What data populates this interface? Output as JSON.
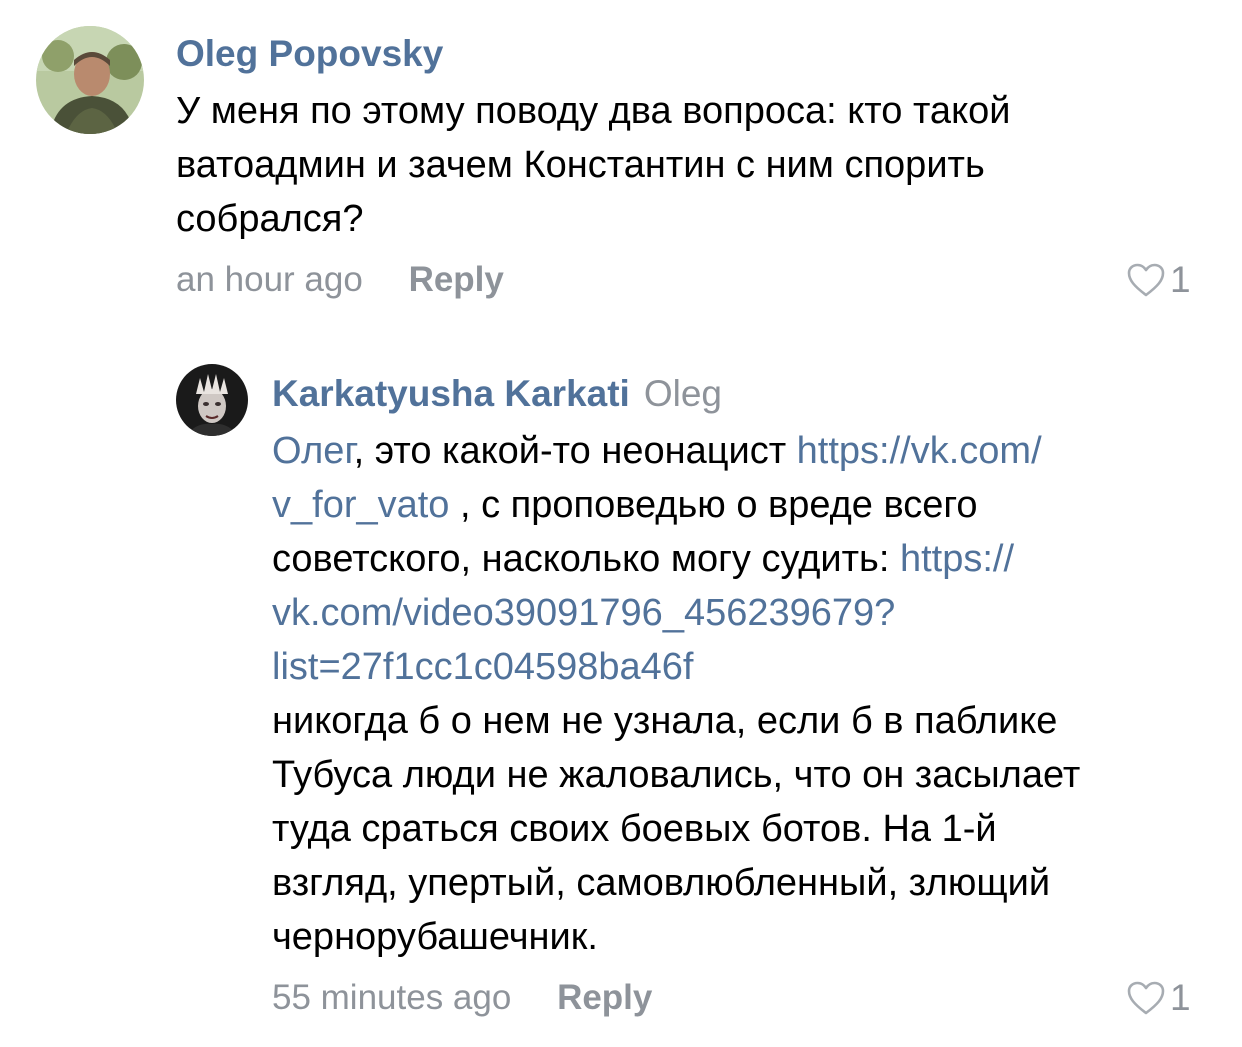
{
  "colors": {
    "author": "#51729a",
    "link": "#51729a",
    "muted": "#8e939a",
    "text": "#000000",
    "background": "#ffffff"
  },
  "comments": [
    {
      "author": "Oleg Popovsky",
      "reply_to": "",
      "avatar_icon": "user-photo-avatar",
      "lines": [
        [
          {
            "t": "У меня по этому поводу два вопроса: кто такой",
            "link": false
          }
        ],
        [
          {
            "t": "ватоадмин и зачем Константин с ним спорить",
            "link": false
          }
        ],
        [
          {
            "t": "собрался?",
            "link": false
          }
        ]
      ],
      "time": "an hour ago",
      "reply_label": "Reply",
      "likes": "1"
    },
    {
      "author": "Karkatyusha Karkati",
      "reply_to": "Oleg",
      "avatar_icon": "user-photo-avatar",
      "lines": [
        [
          {
            "t": "Олег",
            "link": true
          },
          {
            "t": ", это какой-то неонацист ",
            "link": false
          },
          {
            "t": "https://vk.com/",
            "link": true
          }
        ],
        [
          {
            "t": "v_for_vato",
            "link": true
          },
          {
            "t": " , с проповедью о вреде всего",
            "link": false
          }
        ],
        [
          {
            "t": "советского, насколько могу судить: ",
            "link": false
          },
          {
            "t": "https://",
            "link": true
          }
        ],
        [
          {
            "t": "vk.com/video39091796_456239679?",
            "link": true
          }
        ],
        [
          {
            "t": "list=27f1cc1c04598ba46f",
            "link": true
          }
        ],
        [
          {
            "t": "никогда б о нем не узнала, если б в паблике",
            "link": false
          }
        ],
        [
          {
            "t": "Тубуса люди не жаловались, что он засылает",
            "link": false
          }
        ],
        [
          {
            "t": "туда сраться своих боевых ботов. На 1-й",
            "link": false
          }
        ],
        [
          {
            "t": "взгляд, упертый, самовлюбленный, злющий",
            "link": false
          }
        ],
        [
          {
            "t": "чернорубашечник.",
            "link": false
          }
        ]
      ],
      "time": "55 minutes ago",
      "reply_label": "Reply",
      "likes": "1"
    }
  ]
}
